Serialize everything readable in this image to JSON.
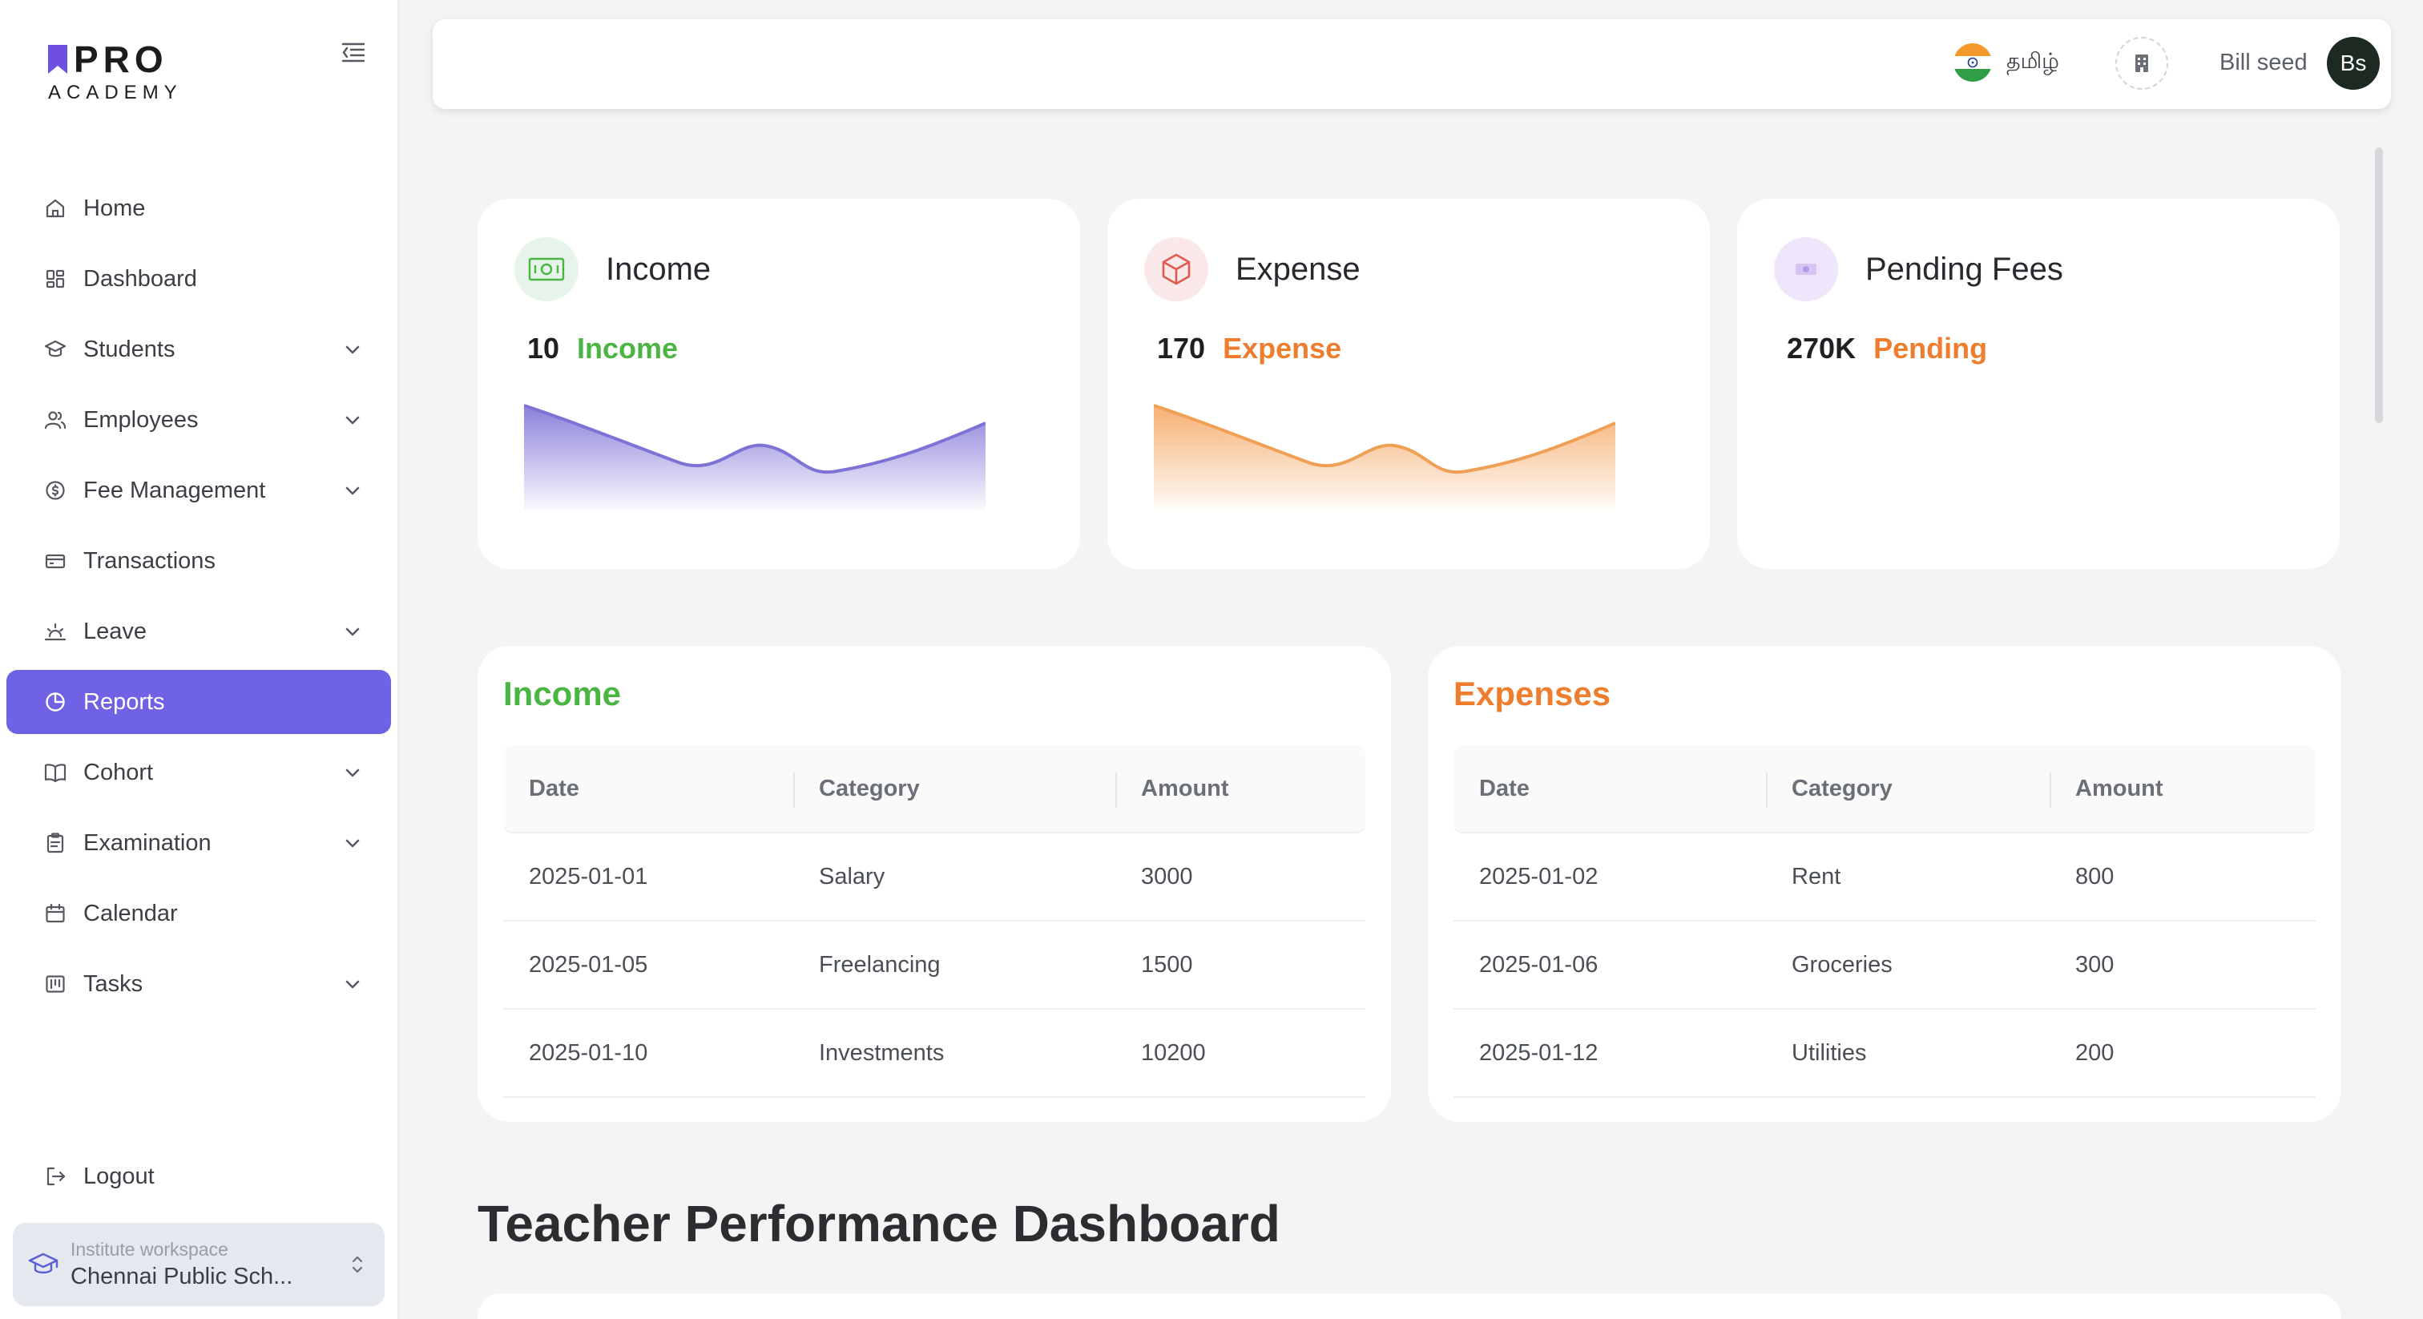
{
  "brand": {
    "name": "PRO",
    "subtitle": "ACADEMY"
  },
  "sidebar": {
    "items": [
      {
        "label": "Home",
        "icon": "home-icon",
        "expandable": false,
        "active": false
      },
      {
        "label": "Dashboard",
        "icon": "dashboard-icon",
        "expandable": false,
        "active": false
      },
      {
        "label": "Students",
        "icon": "students-icon",
        "expandable": true,
        "active": false
      },
      {
        "label": "Employees",
        "icon": "employees-icon",
        "expandable": true,
        "active": false
      },
      {
        "label": "Fee Management",
        "icon": "fee-icon",
        "expandable": true,
        "active": false
      },
      {
        "label": "Transactions",
        "icon": "transactions-icon",
        "expandable": false,
        "active": false
      },
      {
        "label": "Leave",
        "icon": "leave-icon",
        "expandable": true,
        "active": false
      },
      {
        "label": "Reports",
        "icon": "reports-icon",
        "expandable": false,
        "active": true
      },
      {
        "label": "Cohort",
        "icon": "cohort-icon",
        "expandable": true,
        "active": false
      },
      {
        "label": "Examination",
        "icon": "examination-icon",
        "expandable": true,
        "active": false
      },
      {
        "label": "Calendar",
        "icon": "calendar-icon",
        "expandable": false,
        "active": false
      },
      {
        "label": "Tasks",
        "icon": "tasks-icon",
        "expandable": true,
        "active": false
      }
    ],
    "logout_label": "Logout",
    "workspace": {
      "label": "Institute workspace",
      "name": "Chennai Public Sch..."
    }
  },
  "header": {
    "language": "தமிழ்",
    "user_name": "Bill seed",
    "avatar_initials": "Bs"
  },
  "stats": [
    {
      "title": "Income",
      "value": "10",
      "metric": "Income",
      "color": "#4bb543",
      "icon_bg": "#e6f4ea",
      "chart": "purple"
    },
    {
      "title": "Expense",
      "value": "170",
      "metric": "Expense",
      "color": "#ee7d2d",
      "icon_bg": "#fbe9ea",
      "chart": "orange"
    },
    {
      "title": "Pending Fees",
      "value": "270K",
      "metric": "Pending",
      "color": "#ee7d2d",
      "icon_bg": "#efe6fb",
      "chart": "none"
    }
  ],
  "income_table": {
    "title": "Income",
    "columns": [
      "Date",
      "Category",
      "Amount"
    ],
    "rows": [
      [
        "2025-01-01",
        "Salary",
        "3000"
      ],
      [
        "2025-01-05",
        "Freelancing",
        "1500"
      ],
      [
        "2025-01-10",
        "Investments",
        "10200"
      ]
    ]
  },
  "expense_table": {
    "title": "Expenses",
    "columns": [
      "Date",
      "Category",
      "Amount"
    ],
    "rows": [
      [
        "2025-01-02",
        "Rent",
        "800"
      ],
      [
        "2025-01-06",
        "Groceries",
        "300"
      ],
      [
        "2025-01-12",
        "Utilities",
        "200"
      ]
    ]
  },
  "section_title": "Teacher Performance Dashboard",
  "colors": {
    "accent": "#6f62e4",
    "income": "#4bb543",
    "expense": "#ee7d2d"
  }
}
